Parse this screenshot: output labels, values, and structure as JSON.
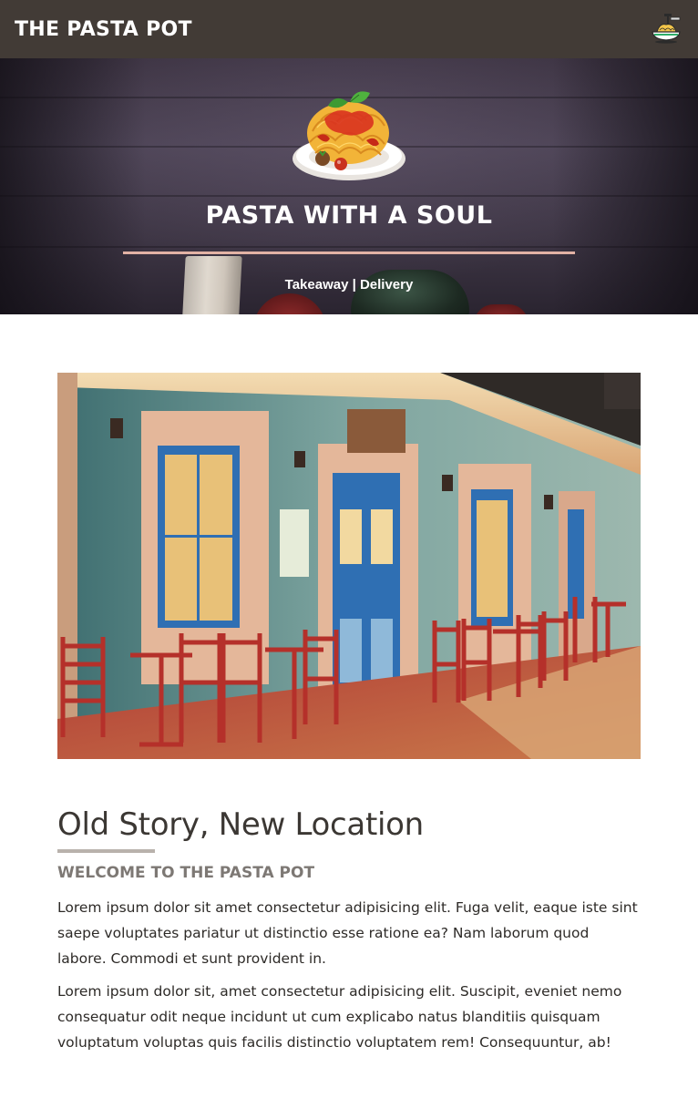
{
  "header": {
    "brand": "THE PASTA POT",
    "icon": "spaghetti-plate-icon"
  },
  "hero": {
    "image": "pasta-plate-icon",
    "title": "PASTA WITH A SOUL",
    "subtitle": "Takeaway | Delivery"
  },
  "intro": {
    "photo": "outdoor-cafe-photo",
    "title": "Old Story, New Location",
    "kicker": "WELCOME TO THE PASTA POT",
    "paragraphs": [
      "Lorem ipsum dolor sit amet consectetur adipisicing elit. Fuga velit, eaque iste sint saepe voluptates pariatur ut distinctio esse ratione ea? Nam laborum quod labore. Commodi et sunt provident in.",
      "Lorem ipsum dolor sit, amet consectetur adipisicing elit. Suscipit, eveniet nemo consequatur odit neque incidunt ut cum explicabo natus blanditiis quisquam voluptatum voluptas quis facilis distinctio voluptatem rem! Consequuntur, ab!"
    ]
  },
  "colors": {
    "navbar": "#423b36",
    "accent_rule": "#e2b2a5",
    "title_text": "#3b3733",
    "kicker_text": "#7d7874"
  }
}
